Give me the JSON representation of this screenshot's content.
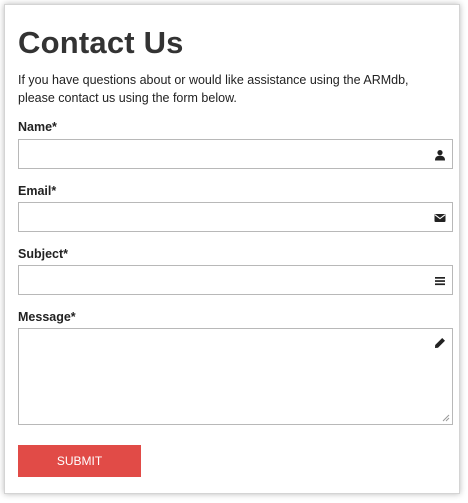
{
  "page": {
    "title": "Contact Us",
    "intro": "If you have questions about or would like assistance using the ARMdb, please contact us using the form below."
  },
  "form": {
    "name": {
      "label": "Name*",
      "value": "",
      "placeholder": "",
      "icon": "user-icon"
    },
    "email": {
      "label": "Email*",
      "value": "",
      "placeholder": "",
      "icon": "envelope-icon"
    },
    "subject": {
      "label": "Subject*",
      "value": "",
      "placeholder": "",
      "icon": "list-icon"
    },
    "message": {
      "label": "Message*",
      "value": "",
      "placeholder": "",
      "icon": "pencil-icon"
    },
    "submit_label": "SUBMIT"
  },
  "colors": {
    "accent": "#e14b47",
    "title_text": "#333333",
    "field_border": "#b8b8b8"
  }
}
